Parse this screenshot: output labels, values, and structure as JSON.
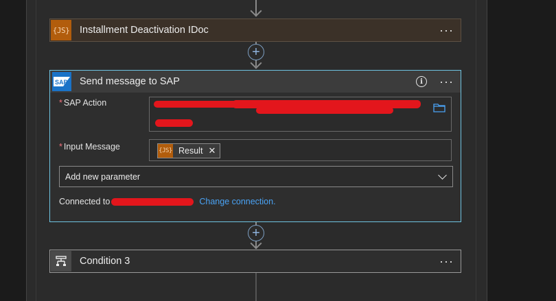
{
  "steps": {
    "idoc": {
      "title": "Installment Deactivation IDoc",
      "icon": "js-icon",
      "more": "···"
    },
    "sap": {
      "title": "Send message to SAP",
      "icon": "sap-logo",
      "more": "···",
      "info": "i",
      "fields": {
        "sap_action": {
          "label": "SAP Action",
          "required": "*"
        },
        "input_message": {
          "label": "Input Message",
          "required": "*",
          "token": "Result",
          "token_icon": "js-icon"
        }
      },
      "add_parameter": "Add new parameter",
      "connected_to_label": "Connected to",
      "change_connection": "Change connection."
    },
    "condition": {
      "title": "Condition 3",
      "icon": "condition-icon",
      "more": "···"
    }
  },
  "colors": {
    "js_badge": "#b25d0c",
    "sap_badge": "#1a73c8",
    "selected_border": "#6fc5e3",
    "link": "#4aa3f5",
    "redaction": "#e3161c"
  }
}
